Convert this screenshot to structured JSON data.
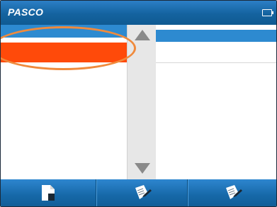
{
  "titlebar": {
    "brand": "PASCO",
    "battery_icon": "battery-icon"
  },
  "list": {
    "selected_index": 0,
    "items": [
      {
        "label": "",
        "state": "selected",
        "color": "#ff4a0a"
      }
    ],
    "header_color": "#2d8ad0"
  },
  "scrollbar": {
    "up_icon": "triangle-up-icon",
    "down_icon": "triangle-down-icon"
  },
  "toolbar": {
    "buttons": [
      {
        "name": "document-icon"
      },
      {
        "name": "file-edit-icon"
      },
      {
        "name": "file-edit-icon"
      }
    ]
  },
  "annotation": {
    "color": "#f08a3c"
  }
}
